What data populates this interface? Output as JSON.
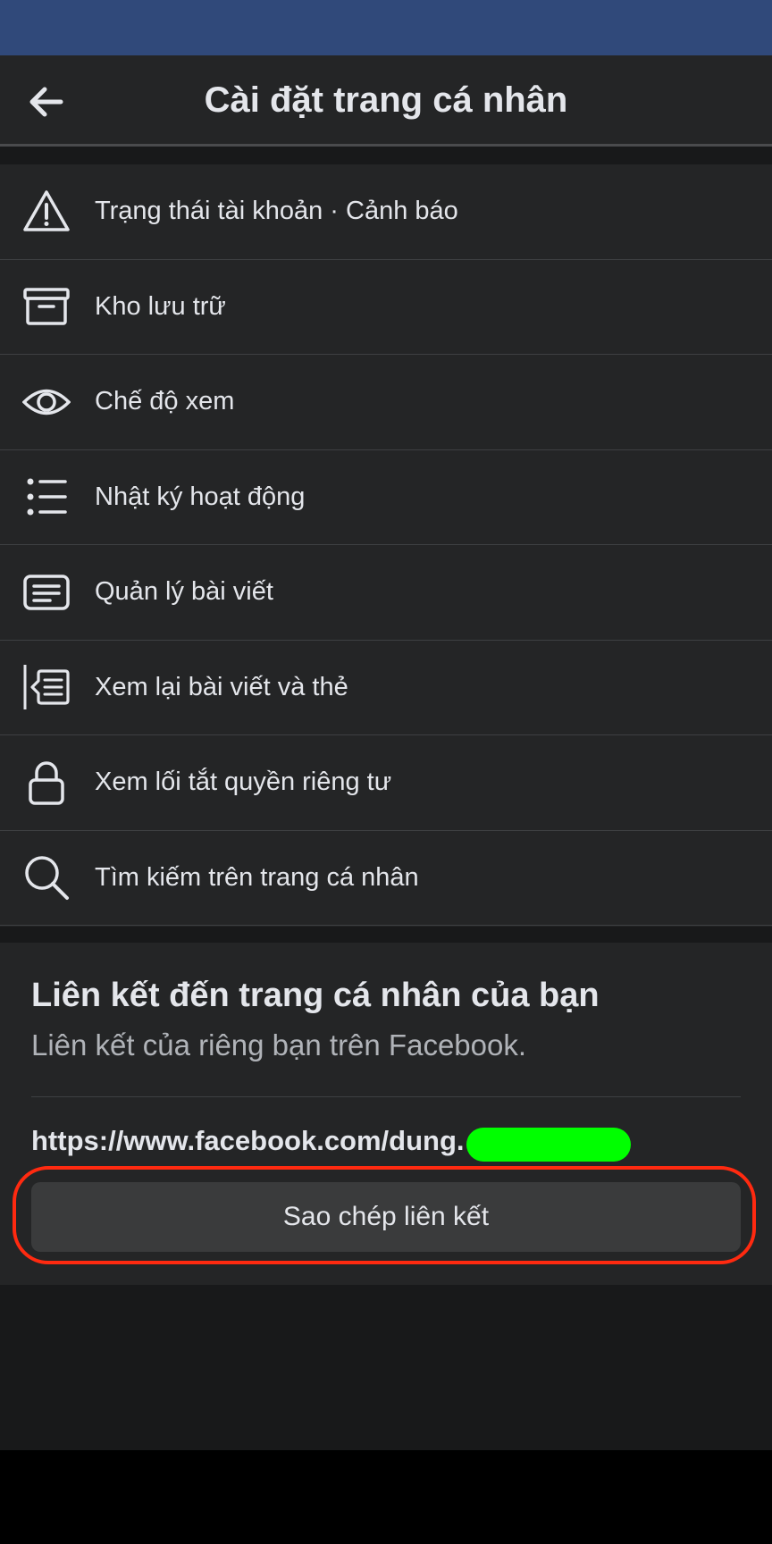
{
  "header": {
    "title": "Cài đặt trang cá nhân",
    "back_icon": "arrow-left-icon"
  },
  "menu": {
    "items": [
      {
        "icon": "warning-triangle-icon",
        "label": "Trạng thái tài khoản · Cảnh báo"
      },
      {
        "icon": "archive-box-icon",
        "label": "Kho lưu trữ"
      },
      {
        "icon": "eye-icon",
        "label": "Chế độ xem"
      },
      {
        "icon": "list-icon",
        "label": "Nhật ký hoạt động"
      },
      {
        "icon": "post-manage-icon",
        "label": "Quản lý bài viết"
      },
      {
        "icon": "review-posts-icon",
        "label": "Xem lại bài viết và thẻ"
      },
      {
        "icon": "lock-icon",
        "label": "Xem lối tắt quyền riêng tư"
      },
      {
        "icon": "search-icon",
        "label": "Tìm kiếm trên trang cá nhân"
      }
    ]
  },
  "profile_link": {
    "heading": "Liên kết đến trang cá nhân của bạn",
    "subtitle": "Liên kết của riêng bạn trên Facebook.",
    "url": "https://www.facebook.com/dung.",
    "copy_button": "Sao chép liên kết"
  },
  "colors": {
    "status_bar": "#30497a",
    "surface": "#242526",
    "redaction": "#00ff00",
    "highlight_ring": "#ff2a10"
  }
}
